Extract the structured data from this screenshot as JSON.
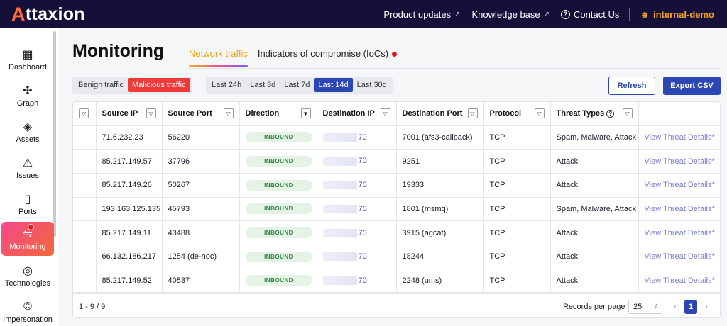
{
  "app": {
    "logo_text": "ttaxion",
    "logo_mark": "A"
  },
  "topnav": {
    "product_updates": "Product updates",
    "knowledge_base": "Knowledge base",
    "contact_us": "Contact Us",
    "user": "internal-demo"
  },
  "sidebar": {
    "items": [
      {
        "label": "Dashboard",
        "icon": "dashboard-icon"
      },
      {
        "label": "Graph",
        "icon": "graph-icon"
      },
      {
        "label": "Assets",
        "icon": "layers-icon"
      },
      {
        "label": "Issues",
        "icon": "warning-icon"
      },
      {
        "label": "Ports",
        "icon": "door-icon"
      },
      {
        "label": "Monitoring",
        "icon": "monitoring-icon"
      },
      {
        "label": "Technologies",
        "icon": "fingerprint-icon"
      },
      {
        "label": "Impersonation",
        "icon": "copyright-icon"
      }
    ],
    "active": "Monitoring"
  },
  "page": {
    "title": "Monitoring",
    "tabs": {
      "network": "Network traffic",
      "ioc": "Indicators of compromise (IoCs)"
    }
  },
  "filters": {
    "traffic": [
      "Benign traffic",
      "Malicious traffic"
    ],
    "traffic_selected": "Malicious traffic",
    "range": [
      "Last 24h",
      "Last 3d",
      "Last 7d",
      "Last 14d",
      "Last 30d"
    ],
    "range_selected": "Last 14d"
  },
  "actions": {
    "refresh": "Refresh",
    "export": "Export CSV"
  },
  "table": {
    "headers": {
      "source_ip": "Source IP",
      "source_port": "Source Port",
      "direction": "Direction",
      "destination_ip": "Destination IP",
      "destination_port": "Destination Port",
      "protocol": "Protocol",
      "threat_types": "Threat Types"
    },
    "rows": [
      {
        "source_ip": "71.6.232.23",
        "source_port": "56220",
        "direction": "INBOUND",
        "dest_ip_suffix": "70",
        "dest_port": "7001 (afs3-callback)",
        "protocol": "TCP",
        "threats": "Spam, Malware, Attack",
        "link": "View Threat Details*"
      },
      {
        "source_ip": "85.217.149.57",
        "source_port": "37796",
        "direction": "INBOUND",
        "dest_ip_suffix": "70",
        "dest_port": "9251",
        "protocol": "TCP",
        "threats": "Attack",
        "link": "View Threat Details*"
      },
      {
        "source_ip": "85.217.149.26",
        "source_port": "50267",
        "direction": "INBOUND",
        "dest_ip_suffix": "70",
        "dest_port": "19333",
        "protocol": "TCP",
        "threats": "Attack",
        "link": "View Threat Details*"
      },
      {
        "source_ip": "193.163.125.135",
        "source_port": "45793",
        "direction": "INBOUND",
        "dest_ip_suffix": "70",
        "dest_port": "1801 (msmq)",
        "protocol": "TCP",
        "threats": "Spam, Malware, Attack",
        "link": "View Threat Details*"
      },
      {
        "source_ip": "85.217.149.11",
        "source_port": "43488",
        "direction": "INBOUND",
        "dest_ip_suffix": "70",
        "dest_port": "3915 (agcat)",
        "protocol": "TCP",
        "threats": "Attack",
        "link": "View Threat Details*"
      },
      {
        "source_ip": "66.132.186.217",
        "source_port": "1254 (de-noc)",
        "direction": "INBOUND",
        "dest_ip_suffix": "70",
        "dest_port": "18244",
        "protocol": "TCP",
        "threats": "Attack",
        "link": "View Threat Details*"
      },
      {
        "source_ip": "85.217.149.52",
        "source_port": "40537",
        "direction": "INBOUND",
        "dest_ip_suffix": "70",
        "dest_port": "2248 (ums)",
        "protocol": "TCP",
        "threats": "Attack",
        "link": "View Threat Details*"
      }
    ]
  },
  "pagination": {
    "count": "1 - 9 / 9",
    "records_per_page_label": "Records per page",
    "records_per_page": "25",
    "current_page": "1"
  },
  "colors": {
    "brand_dark": "#15103a",
    "accent_orange": "#f4a20f",
    "primary_blue": "#2c47b3",
    "danger_red": "#ef3a3a"
  }
}
